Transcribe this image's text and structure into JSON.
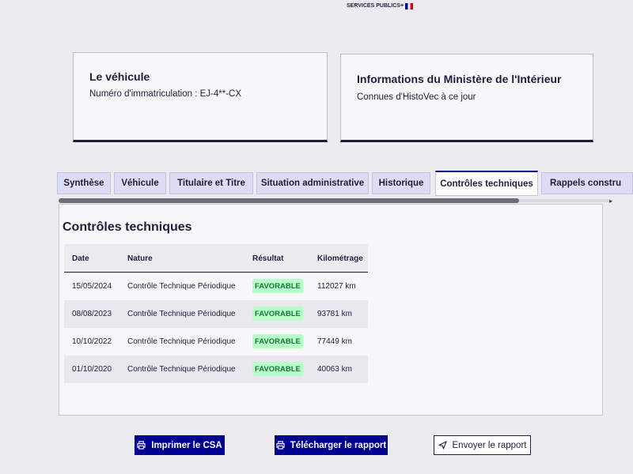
{
  "header": {
    "logo_text": "SERVICES PUBLICS+"
  },
  "cards": {
    "vehicle": {
      "title": "Le véhicule",
      "subtitle": "Numéro d'immatriculation : EJ-4**-CX"
    },
    "ministry": {
      "title": "Informations du Ministère de l'Intérieur",
      "subtitle": "Connues d'HistoVec à ce jour"
    }
  },
  "tabs": [
    {
      "label": "Synthèse",
      "active": false
    },
    {
      "label": "Véhicule",
      "active": false
    },
    {
      "label": "Titulaire et Titre",
      "active": false
    },
    {
      "label": "Situation administrative",
      "active": false
    },
    {
      "label": "Historique",
      "active": false
    },
    {
      "label": "Contrôles techniques",
      "active": true
    },
    {
      "label": "Rappels constru",
      "active": false
    }
  ],
  "panel": {
    "title": "Contrôles techniques",
    "columns": [
      "Date",
      "Nature",
      "Résultat",
      "Kilométrage"
    ],
    "rows": [
      {
        "date": "15/05/2024",
        "nature": "Contrôle Technique Périodique",
        "result": "FAVORABLE",
        "km": "112027 km"
      },
      {
        "date": "08/08/2023",
        "nature": "Contrôle Technique Périodique",
        "result": "FAVORABLE",
        "km": "93781 km"
      },
      {
        "date": "10/10/2022",
        "nature": "Contrôle Technique Périodique",
        "result": "FAVORABLE",
        "km": "77449 km"
      },
      {
        "date": "01/10/2020",
        "nature": "Contrôle Technique Périodique",
        "result": "FAVORABLE",
        "km": "40063 km"
      }
    ]
  },
  "actions": {
    "print": {
      "label": "Imprimer le CSA",
      "icon": "printer-icon"
    },
    "download": {
      "label": "Télécharger le rapport",
      "icon": "printer-icon"
    },
    "send": {
      "label": "Envoyer le rapport",
      "icon": "send-icon"
    }
  },
  "colors": {
    "primary": "#000091",
    "badge_bg": "#b8fec9",
    "badge_text": "#18753c",
    "text": "#1e1e3c"
  }
}
